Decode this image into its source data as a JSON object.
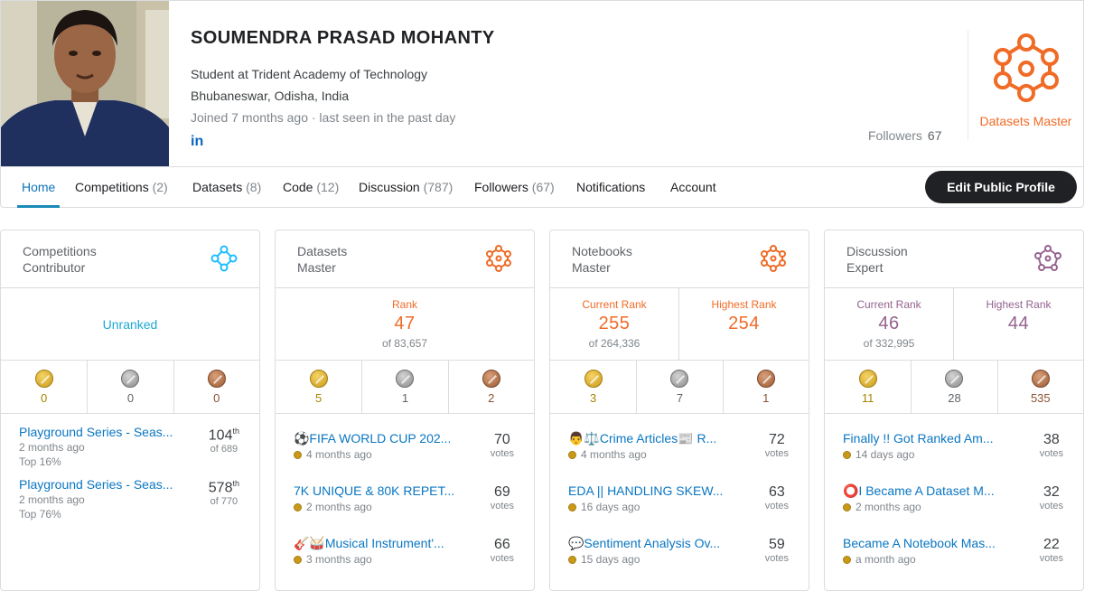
{
  "profile": {
    "name": "SOUMENDRA PRASAD MOHANTY",
    "occupation": "Student at Trident Academy of Technology",
    "location": "Bhubaneswar, Odisha, India",
    "joined": "Joined 7 months ago · last seen in the past day",
    "linkedin": "in",
    "followers_label": "Followers",
    "followers_count": "67",
    "tier": "Datasets Master",
    "tier_color": "#f06b26"
  },
  "tabs": [
    {
      "label": "Home",
      "count": ""
    },
    {
      "label": "Competitions",
      "count": "(2)"
    },
    {
      "label": "Datasets",
      "count": "(8)"
    },
    {
      "label": "Code",
      "count": "(12)"
    },
    {
      "label": "Discussion",
      "count": "(787)"
    },
    {
      "label": "Followers",
      "count": "(67)"
    },
    {
      "label": "Notifications",
      "count": ""
    },
    {
      "label": "Account",
      "count": ""
    }
  ],
  "edit_button": "Edit Public Profile",
  "cards": [
    {
      "title_1": "Competitions",
      "title_2": "Contributor",
      "color": "#20beff",
      "unranked": "Unranked",
      "medals": {
        "gold": "0",
        "silver": "0",
        "bronze": "0"
      },
      "items": [
        {
          "title": "Playground Series - Seas...",
          "sub": "2 months ago",
          "sub2": "Top 16%",
          "rank": "104",
          "suffix": "th",
          "of": "of 689"
        },
        {
          "title": "Playground Series - Seas...",
          "sub": "2 months ago",
          "sub2": "Top 76%",
          "rank": "578",
          "suffix": "th",
          "of": "of 770"
        }
      ]
    },
    {
      "title_1": "Datasets",
      "title_2": "Master",
      "color": "#f06b26",
      "rank_label": "Rank",
      "rank": "47",
      "rank_of": "of 83,657",
      "medals": {
        "gold": "5",
        "silver": "1",
        "bronze": "2"
      },
      "items": [
        {
          "title": "⚽FIFA WORLD CUP 202...",
          "sub": "4 months ago",
          "votes": "70",
          "votes_label": "votes"
        },
        {
          "title": "7K UNIQUE & 80K REPET...",
          "sub": "2 months ago",
          "votes": "69",
          "votes_label": "votes"
        },
        {
          "title": "🎸🥁Musical Instrument'...",
          "sub": "3 months ago",
          "votes": "66",
          "votes_label": "votes"
        }
      ]
    },
    {
      "title_1": "Notebooks",
      "title_2": "Master",
      "color": "#f06b26",
      "current_label": "Current Rank",
      "current": "255",
      "current_of": "of 264,336",
      "highest_label": "Highest Rank",
      "highest": "254",
      "medals": {
        "gold": "3",
        "silver": "7",
        "bronze": "1"
      },
      "items": [
        {
          "title": "👨⚖️Crime Articles📰 R...",
          "sub": "4 months ago",
          "votes": "72",
          "votes_label": "votes"
        },
        {
          "title": "EDA || HANDLING SKEW...",
          "sub": "16 days ago",
          "votes": "63",
          "votes_label": "votes"
        },
        {
          "title": "💬Sentiment Analysis Ov...",
          "sub": "15 days ago",
          "votes": "59",
          "votes_label": "votes"
        }
      ]
    },
    {
      "title_1": "Discussion",
      "title_2": "Expert",
      "color": "#95628f",
      "current_label": "Current Rank",
      "current": "46",
      "current_of": "of 332,995",
      "highest_label": "Highest Rank",
      "highest": "44",
      "medals": {
        "gold": "11",
        "silver": "28",
        "bronze": "535"
      },
      "items": [
        {
          "title": "Finally !! Got Ranked Am...",
          "sub": "14 days ago",
          "votes": "38",
          "votes_label": "votes"
        },
        {
          "title": "⭕I Became A Dataset M...",
          "sub": "2 months ago",
          "votes": "32",
          "votes_label": "votes"
        },
        {
          "title": "Became A Notebook Mas...",
          "sub": "a month ago",
          "votes": "22",
          "votes_label": "votes"
        }
      ]
    }
  ]
}
